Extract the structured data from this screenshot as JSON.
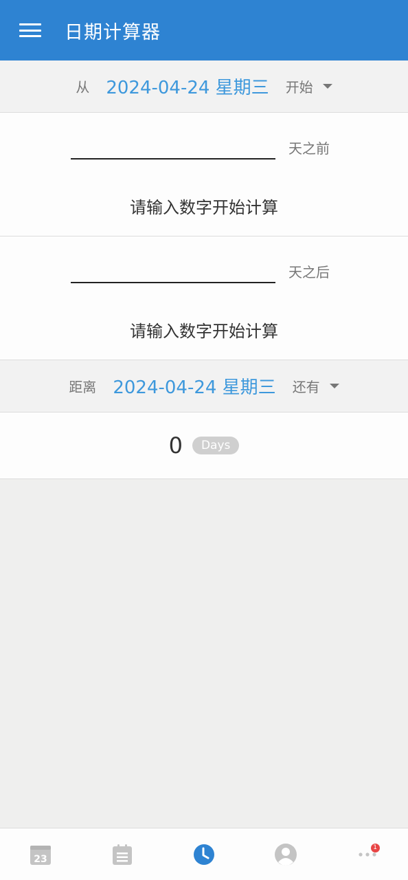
{
  "appbar": {
    "title": "日期计算器",
    "menu_icon": "hamburger-menu-icon"
  },
  "from_row": {
    "label": "从",
    "date": "2024-04-24 星期三",
    "mode": "开始"
  },
  "before_block": {
    "input_value": "",
    "suffix": "天之前",
    "hint": "请输入数字开始计算"
  },
  "after_block": {
    "input_value": "",
    "suffix": "天之后",
    "hint": "请输入数字开始计算"
  },
  "distance_row": {
    "label": "距离",
    "date": "2024-04-24 星期三",
    "mode": "还有"
  },
  "result": {
    "value": "0",
    "unit": "Days"
  },
  "bottom_nav": {
    "items": [
      {
        "name": "calendar",
        "icon": "calendar-23-icon",
        "calendar_day": "23",
        "active": false
      },
      {
        "name": "list",
        "icon": "list-note-icon",
        "active": false
      },
      {
        "name": "clock",
        "icon": "clock-icon",
        "active": true
      },
      {
        "name": "profile",
        "icon": "avatar-icon",
        "active": false
      },
      {
        "name": "more",
        "icon": "more-dots-icon",
        "badge": "1",
        "active": false
      }
    ]
  },
  "colors": {
    "primary": "#2e83d2",
    "accent": "#3d98dc",
    "badge_red": "#e84545",
    "inactive": "#c4c4c4"
  }
}
